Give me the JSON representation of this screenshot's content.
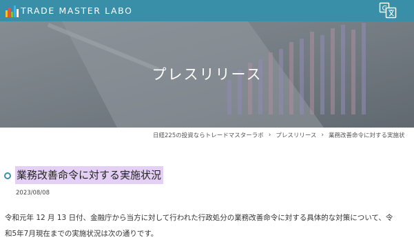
{
  "header": {
    "logo_text": "TRADE MASTER LABO",
    "translate_icon": "translate-icon",
    "brand_color": "#3a8fa8"
  },
  "hero": {
    "title": "プレスリリース"
  },
  "breadcrumb": {
    "items": [
      "日経225の投資ならトレードマスターラボ",
      "プレスリリース",
      "業務改善命令に対する実施状"
    ],
    "separator_icon": "chevron-right-icon"
  },
  "post": {
    "title": "業務改善命令に対する実施状況",
    "title_highlight": "#e4d0f4",
    "date": "2023/08/08",
    "body_line1": "令和元年 12 月 13 日付、金融庁から当方に対して行われた行政処分の業務改善命令に対する具体的な対策について、令",
    "body_line2": "和5年7月現在までの実施状況は次の通りです。"
  }
}
